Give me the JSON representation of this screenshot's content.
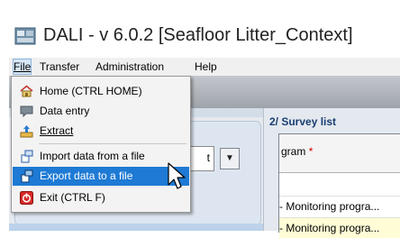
{
  "window": {
    "title": "DALI - v 6.0.2 [Seafloor Litter_Context]"
  },
  "menubar": {
    "items": [
      {
        "label": "File"
      },
      {
        "label": "Transfer"
      },
      {
        "label": "Administration"
      },
      {
        "label": "Help"
      }
    ]
  },
  "file_menu": {
    "items": [
      {
        "label": "Home (CTRL HOME)",
        "icon": "home-icon"
      },
      {
        "label": "Data entry",
        "icon": "data-entry-icon"
      },
      {
        "label": "Extract",
        "icon": "extract-icon"
      },
      {
        "label": "Import data from a file",
        "icon": "import-icon"
      },
      {
        "label": "Export data to a file",
        "icon": "export-icon",
        "highlighted": true
      },
      {
        "label": "Exit (CTRL F)",
        "icon": "exit-icon"
      }
    ]
  },
  "left_panel": {
    "combo_value": "t",
    "combo_arrow": "▼"
  },
  "survey_list": {
    "title": "2/ Survey list",
    "column_header": "gram",
    "required_marker": "*",
    "rows": [
      "- Monitoring progra...",
      "- Monitoring progra..."
    ]
  },
  "colors": {
    "highlight": "#1e7ad4",
    "survey_title": "#1a3e72",
    "required": "#d40000",
    "row_alt": "#fffcd6"
  }
}
